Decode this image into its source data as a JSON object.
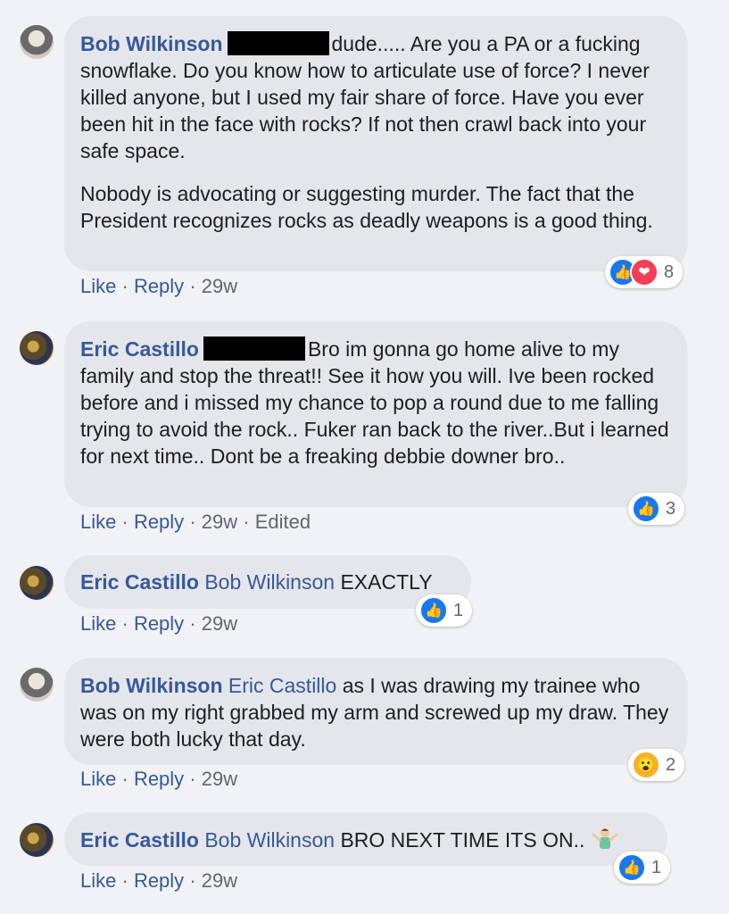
{
  "comments": [
    {
      "author": "Bob Wilkinson",
      "text_line1": "dude..... Are you a PA or a",
      "text_rest": "fucking snowflake. Do you know how to articulate use of force? I never killed anyone, but I used my fair share of force. Have you ever been hit in the face with rocks? If not then crawl back into your safe space.",
      "text_para2": "Nobody is advocating or suggesting murder. The fact that the President recognizes rocks as deadly weapons is a good thing.",
      "like": "Like",
      "reply": "Reply",
      "time": "29w",
      "reaction_count": "8"
    },
    {
      "author": "Eric Castillo",
      "text_line1": "Bro im gonna go home alive to my",
      "text_rest": "family and stop the threat!! See it how you will. Ive been rocked before and i missed my chance to pop a round due to me falling trying to avoid the rock.. Fuker ran back to the river..But i learned for next time.. Dont be a freaking debbie downer bro..",
      "like": "Like",
      "reply": "Reply",
      "time": "29w",
      "edited": "Edited",
      "reaction_count": "3"
    },
    {
      "author": "Eric Castillo",
      "mention": "Bob Wilkinson",
      "text": "EXACTLY",
      "like": "Like",
      "reply": "Reply",
      "time": "29w",
      "reaction_count": "1"
    },
    {
      "author": "Bob Wilkinson",
      "mention": "Eric Castillo",
      "text": "as I was drawing my trainee who was on my right grabbed my arm and screwed up my draw. They were both lucky that day.",
      "like": "Like",
      "reply": "Reply",
      "time": "29w",
      "reaction_count": "2"
    },
    {
      "author": "Eric Castillo",
      "mention": "Bob Wilkinson",
      "text": "BRO NEXT TIME ITS ON..",
      "like": "Like",
      "reply": "Reply",
      "time": "29w",
      "reaction_count": "1"
    }
  ],
  "separator": "·",
  "icons": {
    "like": "thumbs-up-icon",
    "love": "heart-icon",
    "wow": "wow-face-icon",
    "shrug": "person-shrugging-emoji"
  },
  "colors": {
    "author": "#385898",
    "bubble": "#e4e6eb",
    "like_blue": "#1877f2",
    "love_red": "#f33e58",
    "wow_yellow": "#f7b125"
  }
}
